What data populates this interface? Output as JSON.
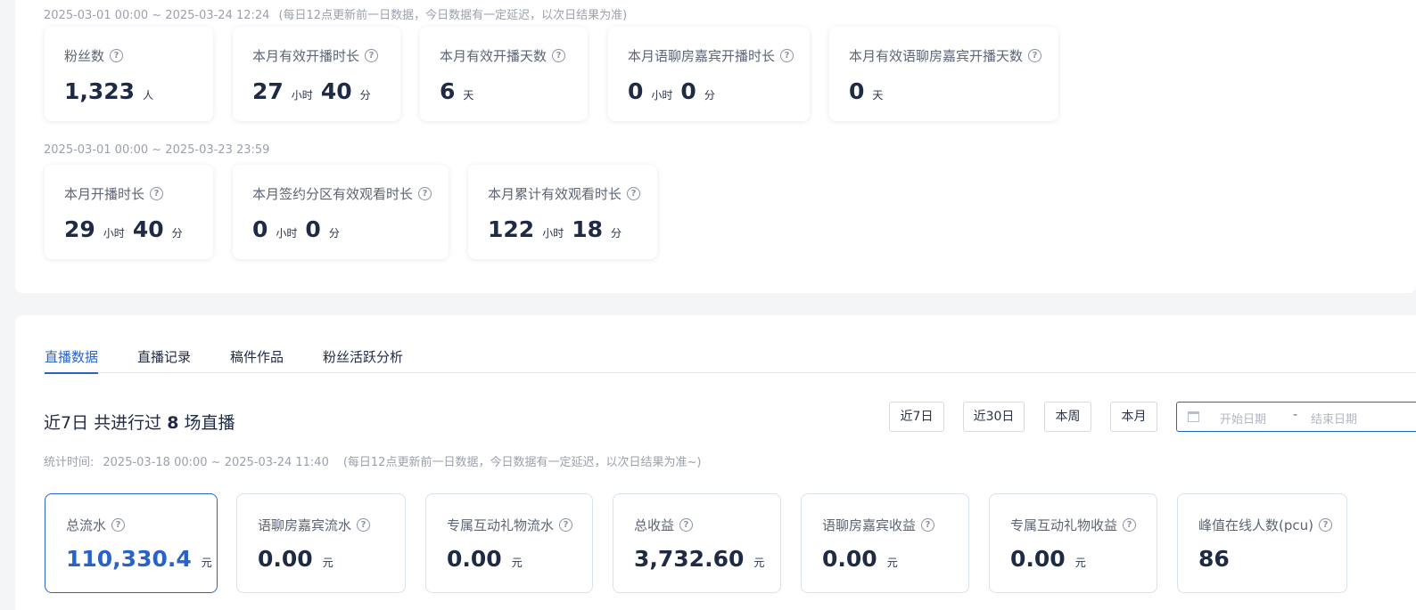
{
  "top": {
    "range1": {
      "dates": "2025-03-01 00:00 ~ 2025-03-24 12:24",
      "note": "(每日12点更新前一日数据，今日数据有一定延迟，以次日结果为准)"
    },
    "cards1": [
      {
        "label": "粉丝数",
        "n1": "1,323",
        "u1": "人"
      },
      {
        "label": "本月有效开播时长",
        "n1": "27",
        "u1": "小时",
        "n2": "40",
        "u2": "分"
      },
      {
        "label": "本月有效开播天数",
        "n1": "6",
        "u1": "天"
      },
      {
        "label": "本月语聊房嘉宾开播时长",
        "n1": "0",
        "u1": "小时",
        "n2": "0",
        "u2": "分"
      },
      {
        "label": "本月有效语聊房嘉宾开播天数",
        "n1": "0",
        "u1": "天"
      }
    ],
    "range2": {
      "dates": "2025-03-01 00:00 ~ 2025-03-23 23:59"
    },
    "cards2": [
      {
        "label": "本月开播时长",
        "n1": "29",
        "u1": "小时",
        "n2": "40",
        "u2": "分"
      },
      {
        "label": "本月签约分区有效观看时长",
        "n1": "0",
        "u1": "小时",
        "n2": "0",
        "u2": "分"
      },
      {
        "label": "本月累计有效观看时长",
        "n1": "122",
        "u1": "小时",
        "n2": "18",
        "u2": "分"
      }
    ],
    "help_icon": "question-circle-icon"
  },
  "tabs": [
    "直播数据",
    "直播记录",
    "稿件作品",
    "粉丝活跃分析"
  ],
  "summary": {
    "prefix": "近7日 共进行过",
    "count": "8",
    "suffix": "场直播"
  },
  "range_buttons": [
    "近7日",
    "近30日",
    "本周",
    "本月"
  ],
  "date_picker": {
    "start_placeholder": "开始日期",
    "separator": "-",
    "end_placeholder": "结束日期",
    "icon": "calendar-icon"
  },
  "stat_time": {
    "label": "统计时间:",
    "value": "2025-03-18 00:00 ~ 2025-03-24 11:40",
    "note": "(每日12点更新前一日数据，今日数据有一定延迟，以次日结果为准~)"
  },
  "stats": [
    {
      "label": "总流水",
      "value": "110,330.4",
      "unit": "元"
    },
    {
      "label": "语聊房嘉宾流水",
      "value": "0.00",
      "unit": "元"
    },
    {
      "label": "专属互动礼物流水",
      "value": "0.00",
      "unit": "元"
    },
    {
      "label": "总收益",
      "value": "3,732.60",
      "unit": "元"
    },
    {
      "label": "语聊房嘉宾收益",
      "value": "0.00",
      "unit": "元"
    },
    {
      "label": "专属互动礼物收益",
      "value": "0.00",
      "unit": "元"
    },
    {
      "label": "峰值在线人数(pcu)",
      "value": "86",
      "unit": ""
    }
  ],
  "colors": {
    "accent": "#2a63c7",
    "text": "#1f2a44",
    "muted": "#9aa1ad"
  }
}
